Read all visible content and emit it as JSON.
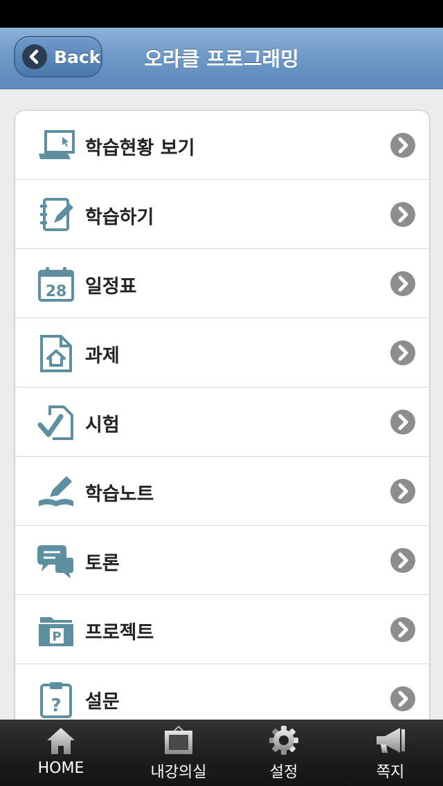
{
  "header": {
    "back_label": "Back",
    "title": "오라클 프로그래밍"
  },
  "menu": {
    "items": [
      {
        "label": "학습현황 보기",
        "icon": "laptop-icon"
      },
      {
        "label": "학습하기",
        "icon": "notebook-pencil-icon"
      },
      {
        "label": "일정표",
        "icon": "calendar-icon"
      },
      {
        "label": "과제",
        "icon": "home-document-icon"
      },
      {
        "label": "시험",
        "icon": "test-check-icon"
      },
      {
        "label": "학습노트",
        "icon": "book-pen-icon"
      },
      {
        "label": "토론",
        "icon": "chat-bubbles-icon"
      },
      {
        "label": "프로젝트",
        "icon": "project-folder-icon"
      },
      {
        "label": "설문",
        "icon": "clipboard-question-icon"
      }
    ],
    "calendar_day": "28",
    "folder_letter": "P",
    "clipboard_mark": "?"
  },
  "tabbar": {
    "items": [
      {
        "label": "HOME",
        "icon": "home-icon"
      },
      {
        "label": "내강의실",
        "icon": "classroom-board-icon"
      },
      {
        "label": "설정",
        "icon": "gear-icon"
      },
      {
        "label": "쪽지",
        "icon": "megaphone-icon"
      }
    ]
  },
  "colors": {
    "nav_bar": "#6c97c6",
    "icon_teal": "#5d8fa1",
    "chevron": "#8d8d8d",
    "tab_bar": "#1c1c1c"
  }
}
